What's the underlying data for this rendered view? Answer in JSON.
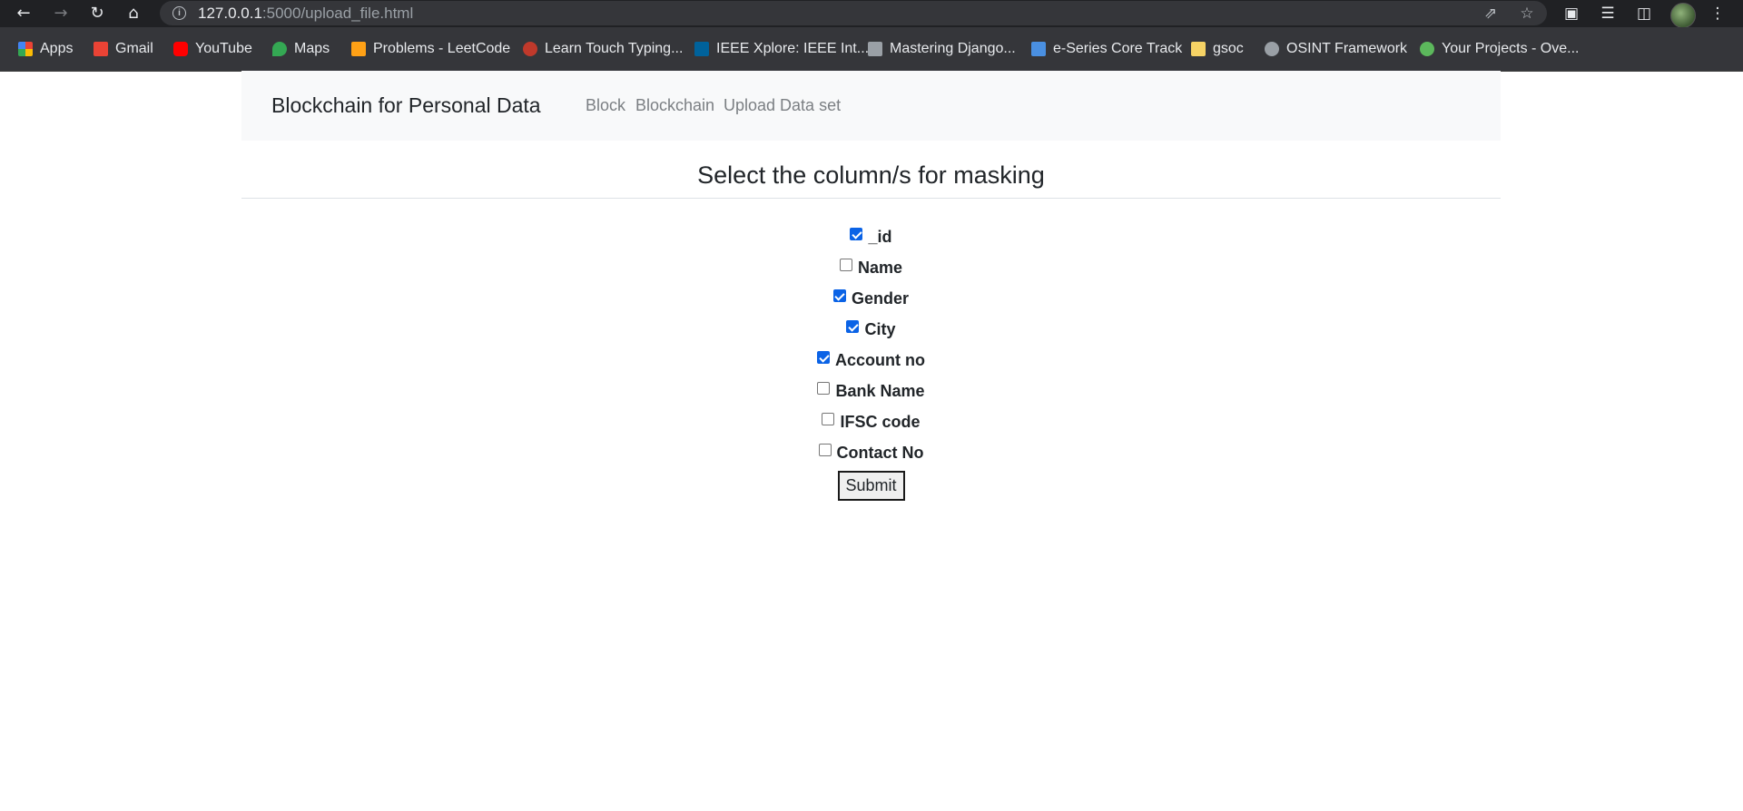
{
  "browser": {
    "url_host": "127.0.0.1",
    "url_path": ":5000/upload_file.html",
    "bookmarks": [
      {
        "label": "Apps",
        "color": "#4285f4"
      },
      {
        "label": "Gmail",
        "color": "#ea4335"
      },
      {
        "label": "YouTube",
        "color": "#ff0000"
      },
      {
        "label": "Maps",
        "color": "#34a853"
      },
      {
        "label": "Problems - LeetCode",
        "color": "#ffa116"
      },
      {
        "label": "Learn Touch Typing...",
        "color": "#c0392b"
      },
      {
        "label": "IEEE Xplore: IEEE Int...",
        "color": "#00629b"
      },
      {
        "label": "Mastering Django...",
        "color": "#9aa0a6"
      },
      {
        "label": "e-Series Core Track",
        "color": "#4a90e2"
      },
      {
        "label": "gsoc",
        "color": "#f6d365"
      },
      {
        "label": "OSINT Framework",
        "color": "#9aa0a6"
      },
      {
        "label": "Your Projects - Ove...",
        "color": "#5cb85c"
      }
    ]
  },
  "navbar": {
    "brand": "Blockchain for Personal Data",
    "links": [
      "Block",
      "Blockchain",
      "Upload Data set"
    ]
  },
  "main": {
    "heading": "Select the column/s for masking",
    "columns": [
      {
        "label": "_id",
        "checked": true
      },
      {
        "label": "Name",
        "checked": false
      },
      {
        "label": "Gender",
        "checked": true
      },
      {
        "label": "City",
        "checked": true
      },
      {
        "label": "Account no",
        "checked": true
      },
      {
        "label": "Bank Name",
        "checked": false
      },
      {
        "label": "IFSC code",
        "checked": false
      },
      {
        "label": "Contact No",
        "checked": false
      }
    ],
    "submit_label": "Submit"
  },
  "colors": {
    "checkbox_checked": "#0b63e6",
    "navbar_bg": "#f8f9fa",
    "chrome_bg": "#202124"
  }
}
